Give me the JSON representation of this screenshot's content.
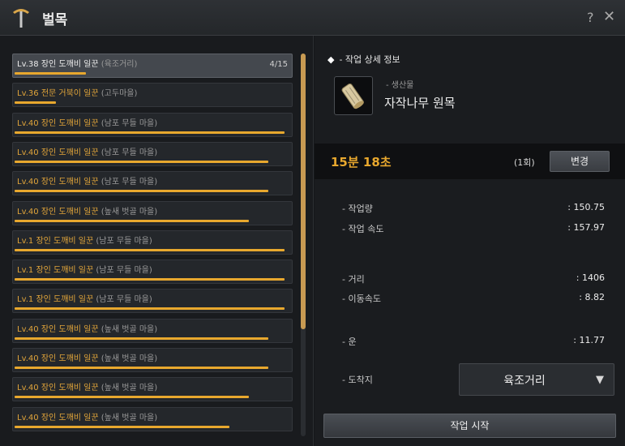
{
  "window": {
    "title": "벌목",
    "help_label": "?",
    "close_label": "✕",
    "icon": "pickaxe-icon"
  },
  "work_list": [
    {
      "level": "Lv.38",
      "name": "장인 도깨비 일꾼",
      "location": "(육조거리)",
      "count": "4/15",
      "progress": 0.26
    },
    {
      "level": "Lv.36",
      "name": "전문 거북이 일꾼",
      "location": "(고두마을)",
      "progress": 0.15
    },
    {
      "level": "Lv.40",
      "name": "장인 도깨비 일꾼",
      "location": "(남포 무들 마을)",
      "progress": 0.98
    },
    {
      "level": "Lv.40",
      "name": "장인 도깨비 일꾼",
      "location": "(남포 무들 마을)",
      "progress": 0.92
    },
    {
      "level": "Lv.40",
      "name": "장인 도깨비 일꾼",
      "location": "(남포 무들 마을)",
      "progress": 0.92
    },
    {
      "level": "Lv.40",
      "name": "장인 도깨비 일꾼",
      "location": "(높새 벗골 마을)",
      "progress": 0.85
    },
    {
      "level": "Lv.1",
      "name": "장인 도깨비 일꾼",
      "location": "(남포 무들 마을)",
      "progress": 0.98
    },
    {
      "level": "Lv.1",
      "name": "장인 도깨비 일꾼",
      "location": "(남포 무들 마을)",
      "progress": 0.98
    },
    {
      "level": "Lv.1",
      "name": "장인 도깨비 일꾼",
      "location": "(남포 무들 마을)",
      "progress": 0.98
    },
    {
      "level": "Lv.40",
      "name": "장인 도깨비 일꾼",
      "location": "(높새 벗골 마을)",
      "progress": 0.92
    },
    {
      "level": "Lv.40",
      "name": "장인 도깨비 일꾼",
      "location": "(높새 벗골 마을)",
      "progress": 0.92
    },
    {
      "level": "Lv.40",
      "name": "장인 도깨비 일꾼",
      "location": "(높새 벗골 마을)",
      "progress": 0.85
    },
    {
      "level": "Lv.40",
      "name": "장인 도깨비 일꾼",
      "location": "(높새 벗골 마을)",
      "progress": 0.78
    }
  ],
  "detail": {
    "section_title": "- 작업 상세 정보",
    "product_sub_label": "- 생산물",
    "product_name": "자작나무 원목",
    "time": "15분 18초",
    "times": "(1회)",
    "change_button": "변경",
    "stats": [
      {
        "label": "- 작업량",
        "value": ": 150.75"
      },
      {
        "label": "- 작업 속도",
        "value": ": 157.97"
      },
      {
        "label": "- 거리",
        "value": ": 1406"
      },
      {
        "label": "- 이동속도",
        "value": ": 8.82"
      },
      {
        "label": "- 운",
        "value": ": 11.77"
      }
    ],
    "destination_label": "- 도착지",
    "destination_value": "육조거리",
    "start_button": "작업 시작"
  },
  "colors": {
    "accent": "#e8a82e",
    "item_name_orange": "#e0a43a",
    "background": "#15171a"
  }
}
